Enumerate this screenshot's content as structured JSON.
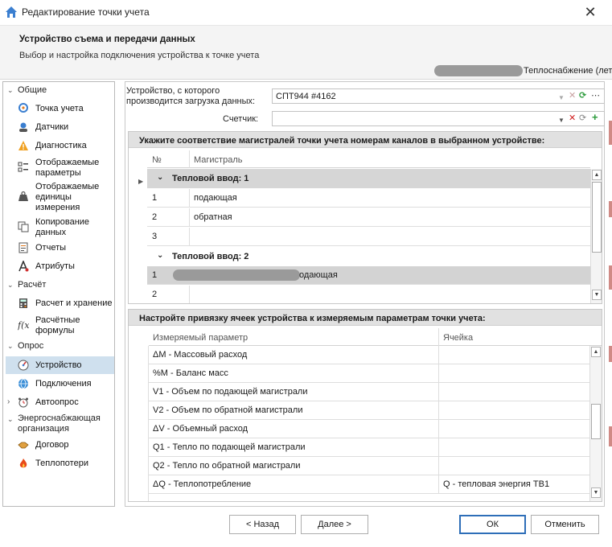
{
  "window": {
    "title": "Редактирование точки учета",
    "close": "✕"
  },
  "header": {
    "title": "Устройство съема и передачи данных",
    "subtitle": "Выбор и настройка подключения устройства к точке учета",
    "org_suffix": "Теплоснабжение (лет"
  },
  "sidebar": {
    "groups": [
      {
        "label": "Общие",
        "items": [
          {
            "label": "Точка учета",
            "icon": "map-pin-icon"
          },
          {
            "label": "Датчики",
            "icon": "sensor-icon"
          },
          {
            "label": "Диагностика",
            "icon": "warning-icon"
          },
          {
            "label": "Отображаемые параметры",
            "icon": "checklist-icon"
          },
          {
            "label": "Отображаемые единицы измерения",
            "icon": "weight-icon"
          },
          {
            "label": "Копирование данных",
            "icon": "copy-icon"
          },
          {
            "label": "Отчеты",
            "icon": "report-icon"
          },
          {
            "label": "Атрибуты",
            "icon": "attribute-icon"
          }
        ]
      },
      {
        "label": "Расчёт",
        "items": [
          {
            "label": "Расчет и хранение",
            "icon": "calculator-icon"
          },
          {
            "label": "Расчётные формулы",
            "icon": "function-icon"
          }
        ]
      },
      {
        "label": "Опрос",
        "items": [
          {
            "label": "Устройство",
            "icon": "device-icon"
          },
          {
            "label": "Подключения",
            "icon": "globe-icon"
          },
          {
            "label": "Автоопрос",
            "icon": "alarm-clock-icon"
          }
        ]
      },
      {
        "label": "Энергоснабжающая организация",
        "items": [
          {
            "label": "Договор",
            "icon": "handshake-icon"
          },
          {
            "label": "Теплопотери",
            "icon": "flame-icon"
          }
        ]
      }
    ]
  },
  "device": {
    "label": "Устройство, с которого производится загрузка данных:",
    "value": "СПТ944 #4162",
    "counter_label": "Счетчик:",
    "counter_value": ""
  },
  "channels": {
    "title": "Укажите соответствие магистралей точки учета номерам каналов в выбранном устройстве:",
    "col_no": "№",
    "col_main": "Магистраль",
    "group1": "Тепловой ввод: 1",
    "rows1": [
      {
        "no": "1",
        "main": "подающая"
      },
      {
        "no": "2",
        "main": "обратная"
      },
      {
        "no": "3",
        "main": ""
      }
    ],
    "group2": "Тепловой ввод: 2",
    "rows2": [
      {
        "no": "1",
        "main": "одающая"
      },
      {
        "no": "2",
        "main": ""
      }
    ]
  },
  "binding": {
    "title": "Настройте привязку ячеек устройства к измеряемым параметрам точки учета:",
    "col_param": "Измеряемый параметр",
    "col_cell": "Ячейка",
    "rows": [
      {
        "param": "ΔМ - Массовый расход",
        "cell": ""
      },
      {
        "param": "%М - Баланс масс",
        "cell": ""
      },
      {
        "param": "V1 - Объем по подающей магистрали",
        "cell": ""
      },
      {
        "param": "V2 - Объем по обратной магистрали",
        "cell": ""
      },
      {
        "param": "ΔV - Объемный расход",
        "cell": ""
      },
      {
        "param": "Q1 - Тепло по подающей магистрали",
        "cell": ""
      },
      {
        "param": "Q2 - Тепло по обратной магистрали",
        "cell": ""
      },
      {
        "param": "ΔQ - Теплопотребление",
        "cell": "Q - тепловая энергия ТВ1"
      }
    ]
  },
  "buttons": {
    "back": "< Назад",
    "next": "Далее >",
    "ok": "ОК",
    "cancel": "Отменить"
  },
  "colors": {
    "accent": "#2e6eb8",
    "selected": "#cfe0ee",
    "group_bg": "#d6d6d6"
  }
}
